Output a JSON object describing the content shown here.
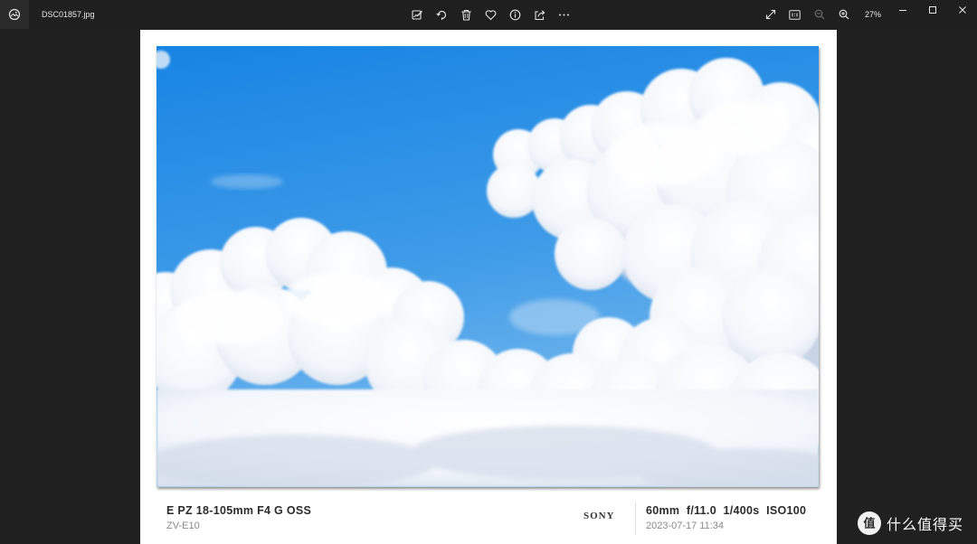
{
  "window": {
    "file_name": "DSC01857.jpg",
    "zoom_level": "27%"
  },
  "toolbar": {
    "items": [
      {
        "icon": "edit-image-icon"
      },
      {
        "icon": "rotate-icon"
      },
      {
        "icon": "delete-icon"
      },
      {
        "icon": "favorite-heart-icon"
      },
      {
        "icon": "info-icon"
      },
      {
        "icon": "share-icon"
      },
      {
        "icon": "more-options-icon"
      }
    ]
  },
  "right_tools": {
    "items": [
      {
        "icon": "fullscreen-icon"
      },
      {
        "icon": "actual-size-icon"
      },
      {
        "icon": "zoom-out-icon"
      },
      {
        "icon": "zoom-in-icon"
      }
    ]
  },
  "photo": {
    "subject": "blue sky with white cumulus clouds"
  },
  "caption": {
    "lens": "E PZ 18-105mm F4 G OSS",
    "model": "ZV-E10",
    "brand": "SONY",
    "exif": "60mm  f/11.0  1/400s  ISO100",
    "datetime": "2023-07-17 11:34"
  },
  "watermark": {
    "text": "什么值得买"
  },
  "colors": {
    "background": "#202020",
    "sky_top": "#1a86e4",
    "sky_bottom": "#5aa8ea",
    "card": "#ffffff"
  }
}
